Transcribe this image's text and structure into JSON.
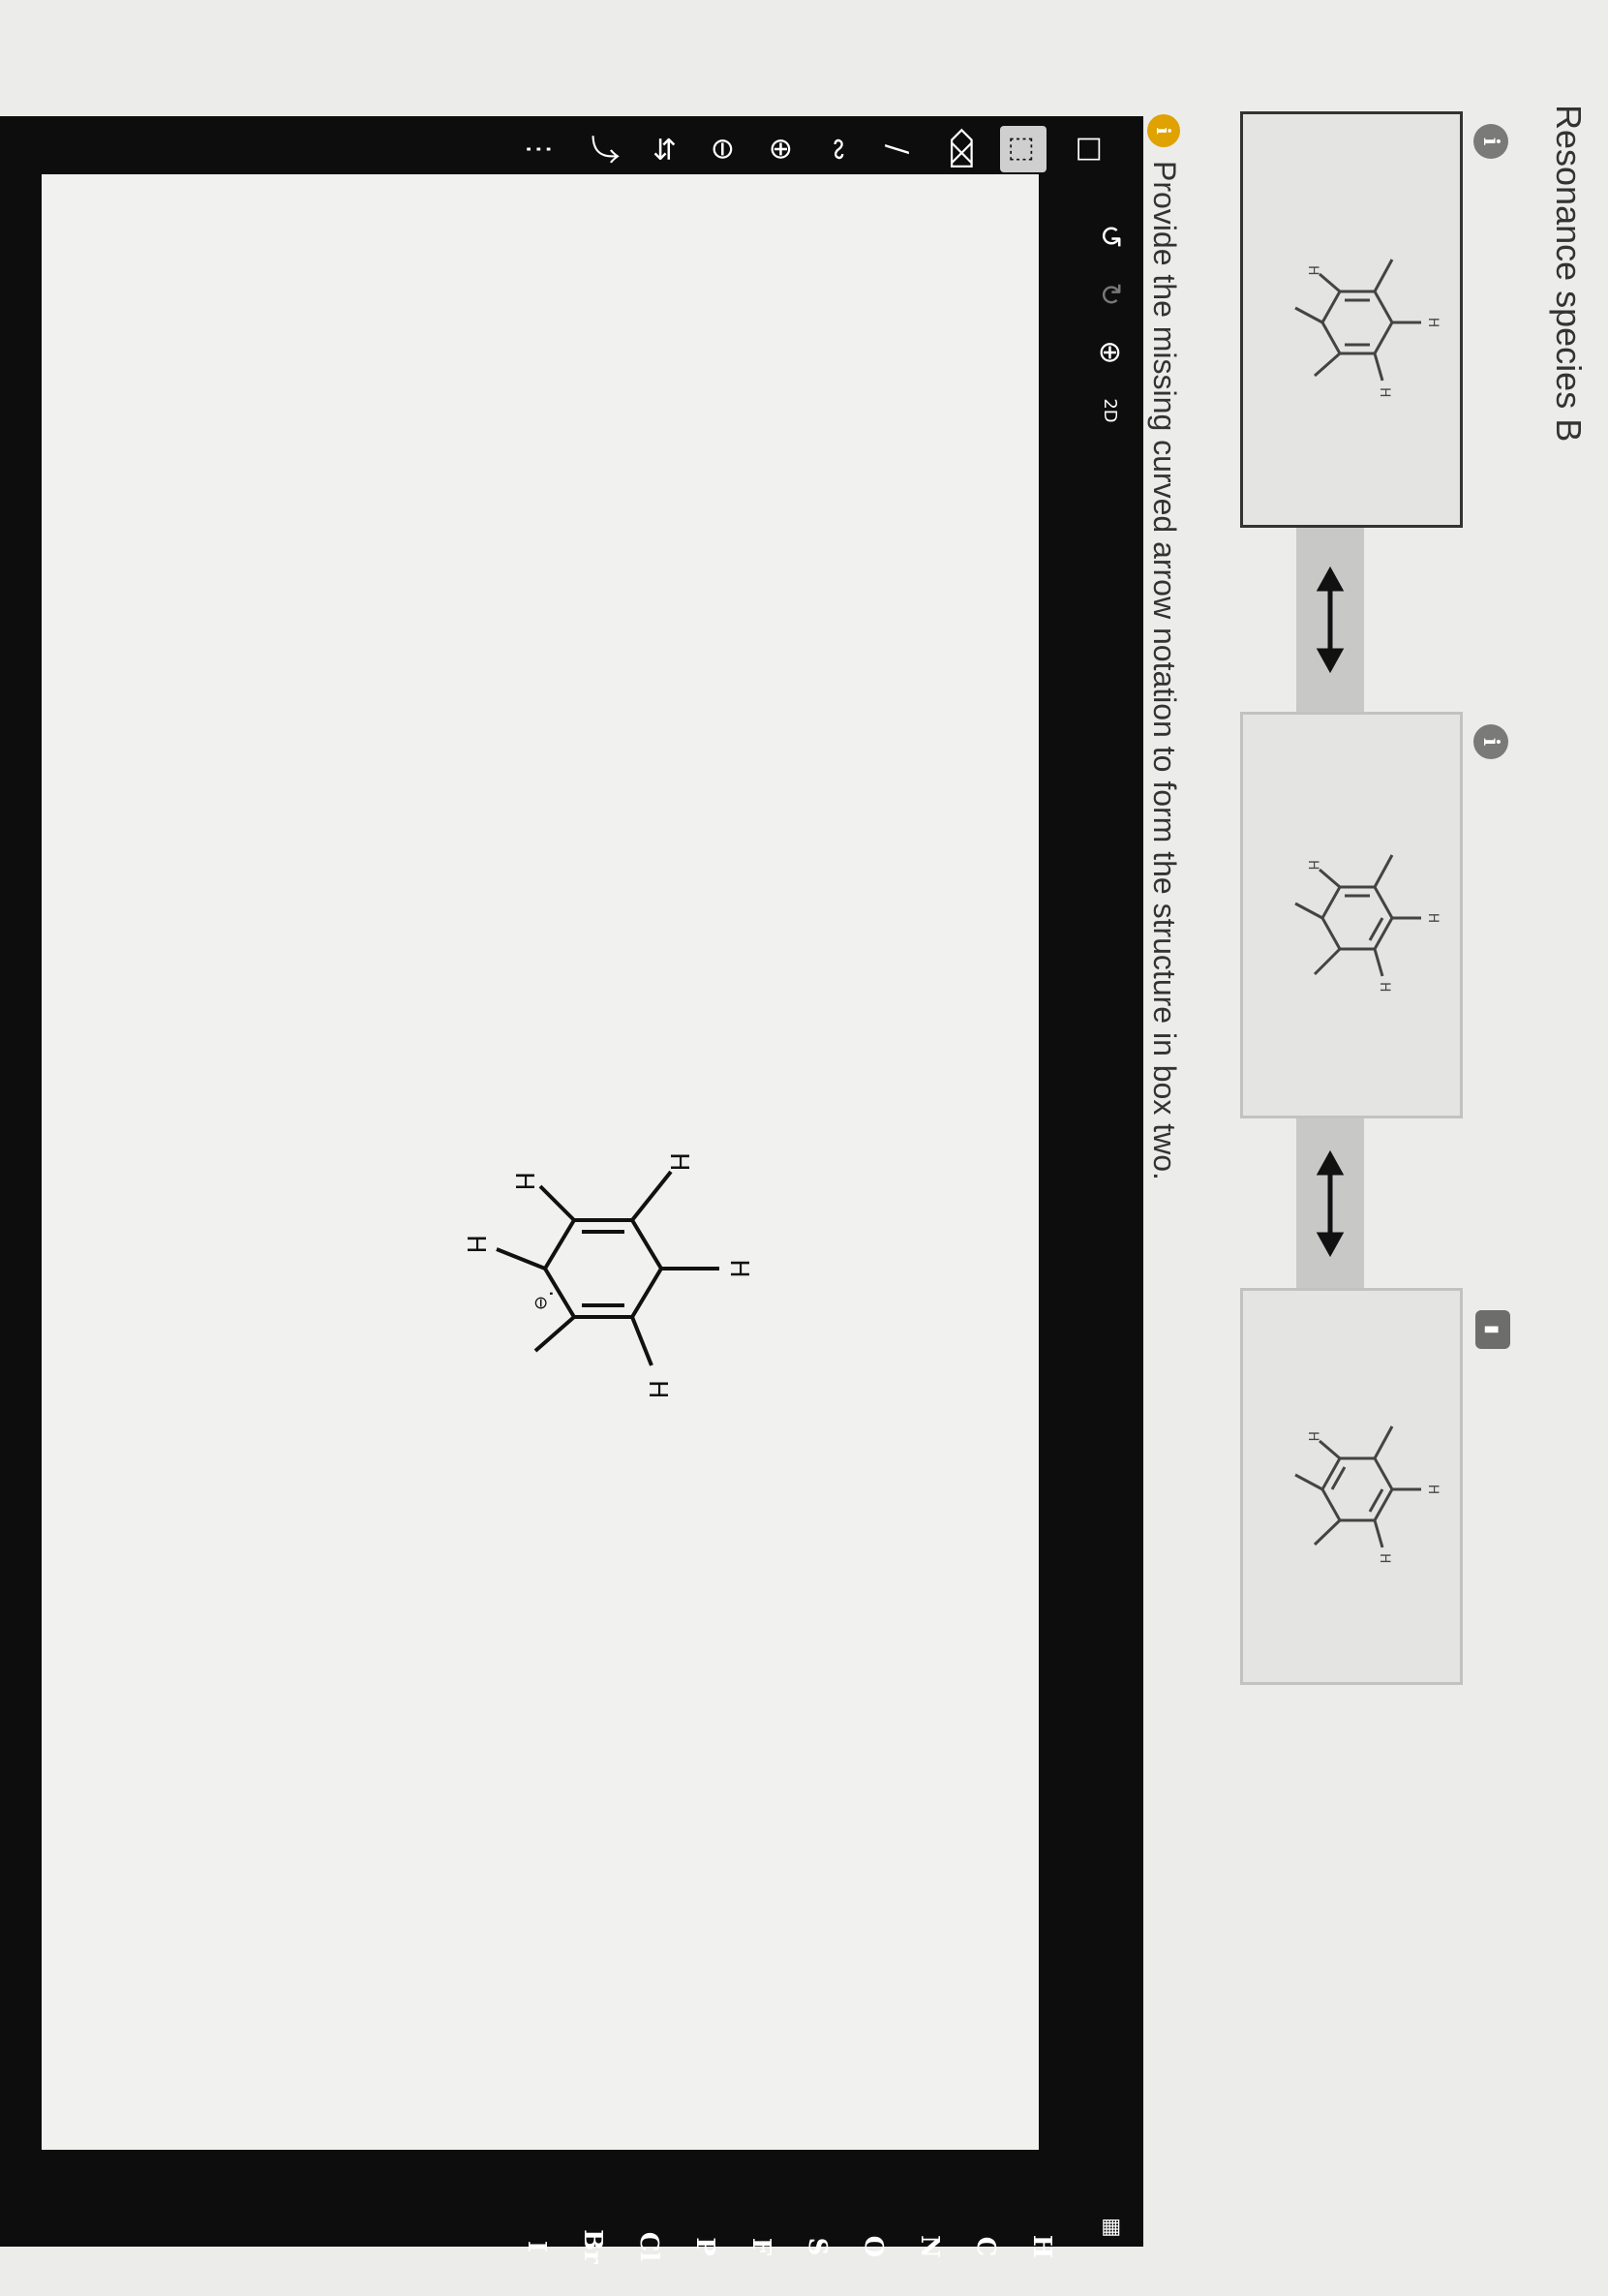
{
  "heading": "Resonance species B",
  "prompt": "Provide the missing curved arrow notation to form the structure in box two.",
  "info_glyph": "i",
  "panels": [
    {
      "name": "box-one",
      "selected": true,
      "locked": false
    },
    {
      "name": "box-two",
      "selected": false,
      "locked": false
    },
    {
      "name": "box-three",
      "selected": false,
      "locked": true
    }
  ],
  "atom_label_h": "H",
  "charge_minus": "⊖",
  "lone_pair": ":",
  "toolbar": {
    "icons": [
      "new-document-icon",
      "marquee-select-icon",
      "eraser-icon",
      "bond-icon",
      "chain-icon",
      "plus-charge-icon",
      "minus-charge-icon",
      "electron-flow-icon",
      "curved-arrow-icon",
      "lone-pair-icon"
    ],
    "top": [
      "undo-icon",
      "redo-icon",
      "zoom-reset-icon",
      "2d-3d-toggle-icon"
    ],
    "two_d_label": "2D"
  },
  "elements": [
    "H",
    "C",
    "N",
    "O",
    "S",
    "F",
    "P",
    "Cl",
    "Br",
    "I"
  ],
  "colors": {
    "panel_border": "#333333",
    "info": "#7a7a78",
    "prompt_info": "#e0a200",
    "editor_bg": "#0d0d0d"
  }
}
